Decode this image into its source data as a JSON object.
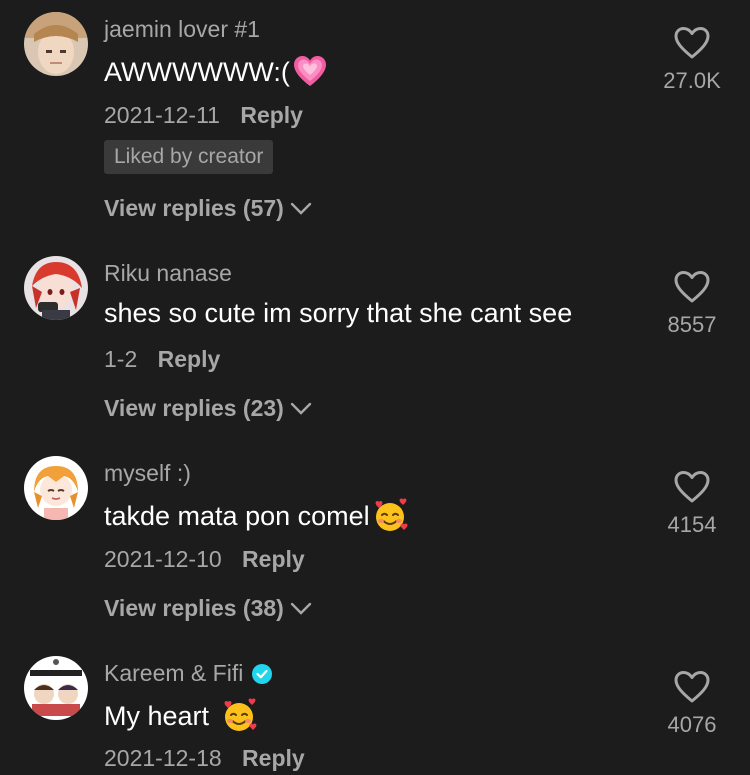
{
  "comments": [
    {
      "username": "jaemin lover #1",
      "text": "AWWWWWW:(",
      "date": "2021-12-11",
      "reply_label": "Reply",
      "badge": "Liked by creator",
      "view_replies": "View replies (57)",
      "likes": "27.0K",
      "emoji": "pink-heart"
    },
    {
      "username": "Riku nanase",
      "text": "shes so cute im sorry that she cant see",
      "date": "1-2",
      "reply_label": "Reply",
      "view_replies": "View replies (23)",
      "likes": "8557"
    },
    {
      "username": "myself :)",
      "text": "takde mata pon comel",
      "date": "2021-12-10",
      "reply_label": "Reply",
      "view_replies": "View replies (38)",
      "likes": "4154",
      "emoji": "smiling-face-with-hearts"
    },
    {
      "username": "Kareem & Fifi",
      "verified": true,
      "text": "My heart",
      "date": "2021-12-18",
      "reply_label": "Reply",
      "likes": "4076",
      "emoji": "smiling-face-with-hearts"
    }
  ],
  "colors": {
    "background": "#1c1c1c",
    "primary_text": "#ffffff",
    "secondary_text": "#a7a7a7",
    "badge_bg": "#3a3a3a",
    "verified": "#20d5ec"
  }
}
